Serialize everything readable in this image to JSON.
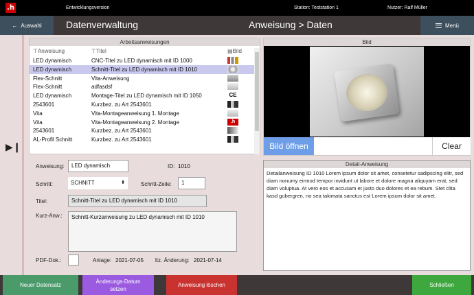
{
  "topbar": {
    "logo": ".h",
    "env": "Entwicklungsversion",
    "station": "Station:  Teststation 1",
    "user": "Nutzer:  Ralf Müller"
  },
  "header": {
    "back_label": "Auswahl",
    "page_title": "Datenverwaltung",
    "center_title": "Anweisung > Daten",
    "menu_label": "Menü"
  },
  "list": {
    "title": "Arbeitsanweisungen",
    "columns": [
      "Anweisung",
      "Titel",
      "Bild"
    ],
    "rows": [
      {
        "anweisung": "LED dynamisch",
        "titel": "CNC-Titel zu LED dynamisch mit ID 1000",
        "thumb": "th-a"
      },
      {
        "anweisung": "LED dynamisch",
        "titel": "Schnitt-Titel zu LED dynamisch mit ID 1010",
        "thumb": "th-b"
      },
      {
        "anweisung": "Flex-Schnitt",
        "titel": "Vita-Anweisung",
        "thumb": "th-c"
      },
      {
        "anweisung": "Flex-Schnitt",
        "titel": "adfasdsf",
        "thumb": "th-d"
      },
      {
        "anweisung": "LED dynamisch",
        "titel": "Montage-Titel zu LED dynamisch mit ID 1050",
        "thumb": "th-e",
        "thumb_text": "CE"
      },
      {
        "anweisung": "2543601",
        "titel": "Kurzbez. zu Art 2543601",
        "thumb": "th-f"
      },
      {
        "anweisung": "Vita",
        "titel": "Vita-Montageanweisung 1. Montage",
        "thumb": "th-d"
      },
      {
        "anweisung": "Vita",
        "titel": "Vita-Montageanweisung 2. Montage",
        "thumb": "th-g",
        "thumb_text": ".h"
      },
      {
        "anweisung": "2543601",
        "titel": "Kurzbez. zu Art 2543601",
        "thumb": "th-h"
      },
      {
        "anweisung": "AL-Profil Schnitt",
        "titel": "Kurzbez. zu Art 2543601",
        "thumb": "th-f"
      }
    ],
    "selected_index": 1
  },
  "form": {
    "anweisung_label": "Anweisung:",
    "anweisung_value": "LED dynamisch",
    "id_label": "ID:",
    "id_value": "1010",
    "schritt_label": "Schritt:",
    "schritt_value": "SCHNITT",
    "schritt_zeile_label": "Schritt-Zeile:",
    "schritt_zeile_value": "1",
    "titel_label": "Titel:",
    "titel_value": "Schnitt-Titel zu LED dynamisch mit ID 1010",
    "kurz_label": "Kurz-Anw.:",
    "kurz_value": "Schnitt-Kurzanweisung zu LED dynamisch mit ID 1010",
    "pdf_label": "PDF-Dok.:",
    "anlage_label": "Anlage:",
    "anlage_value": "2021-07-05",
    "aenderung_label": "ltz. Änderung:",
    "aenderung_value": "2021-07-14"
  },
  "image_panel": {
    "title": "Bild",
    "open_label": "Bild öffnen",
    "clear_label": "Clear"
  },
  "detail": {
    "title": "Detail-Anweisung",
    "text": "Detailanweisung ID 1010 Lorem ipsum dolor sit amet, consetetur sadipscing elitr, sed diam nonumy eirmod tempor invidunt ut labore et dolore magna aliquyam erat, sed diam voluptua. At vero eos et accusam et justo duo dolores et ea rebum. Stet clita kasd gubergren, no sea takimata sanctus est Lorem ipsum dolor sit amet."
  },
  "footer": {
    "new_label": "Neuer Datensatz",
    "date_label_1": "Änderungs-Datum",
    "date_label_2": "setzen",
    "delete_label": "Anweisung löschen",
    "close_label": "Schließen"
  },
  "colors": {
    "new": "#4a9a6a",
    "date": "#9a5be0",
    "delete": "#c9322f",
    "close": "#3ea83e",
    "header": "#3f3838",
    "selected_row": "#c9c9ee"
  }
}
